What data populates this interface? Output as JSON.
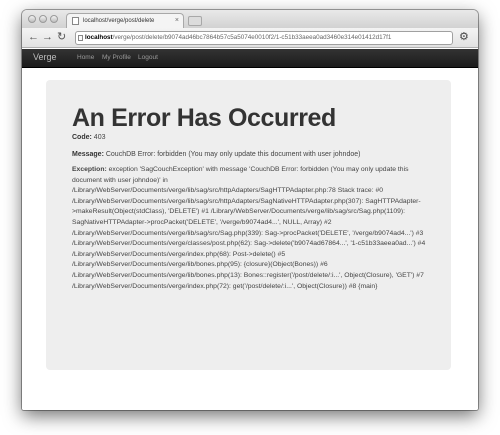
{
  "browser": {
    "tab_title": "localhost/verge/post/delete",
    "tab_close": "×",
    "url_prefix": "localhost",
    "url_path": "/verge/post/delete/b9074ad46bc7864b57c5a5074e0010f2/1-c51b33aeea0ad3460e314e01412d17f1",
    "back_icon": "←",
    "forward_icon": "→",
    "reload_icon": "↻",
    "menu_icon": "wrench-icon"
  },
  "navbar": {
    "brand": "Verge",
    "links": [
      "Home",
      "My Profile",
      "Logout"
    ]
  },
  "error": {
    "title": "An Error Has Occurred",
    "code_label": "Code:",
    "code_value": "403",
    "message_label": "Message:",
    "message_value": "CouchDB Error: forbidden (You may only update this document with user johndoe)",
    "exception_label": "Exception:",
    "exception_value": "exception 'SagCouchException' with message 'CouchDB Error: forbidden (You may only update this document with user johndoe)' in /Library/WebServer/Documents/verge/lib/sag/src/httpAdapters/SagHTTPAdapter.php:78 Stack trace: #0 /Library/WebServer/Documents/verge/lib/sag/src/httpAdapters/SagNativeHTTPAdapter.php(307): SagHTTPAdapter->makeResult(Object(stdClass), 'DELETE') #1 /Library/WebServer/Documents/verge/lib/sag/src/Sag.php(1109): SagNativeHTTPAdapter->procPacket('DELETE', '/verge/b9074ad4...', NULL, Array) #2 /Library/WebServer/Documents/verge/lib/sag/src/Sag.php(339): Sag->procPacket('DELETE', '/verge/b9074ad4...') #3 /Library/WebServer/Documents/verge/classes/post.php(62): Sag->delete('b9074ad67864...', '1-c51b33aeea0ad...') #4 /Library/WebServer/Documents/verge/index.php(68): Post->delete() #5 /Library/WebServer/Documents/verge/lib/bones.php(95): {closure}(Object(Bones)) #6 /Library/WebServer/Documents/verge/lib/bones.php(13): Bones::register('/post/delete/:i...', Object(Closure), 'GET') #7 /Library/WebServer/Documents/verge/index.php(72): get('/post/delete/:i...', Object(Closure)) #8 {main}"
  }
}
